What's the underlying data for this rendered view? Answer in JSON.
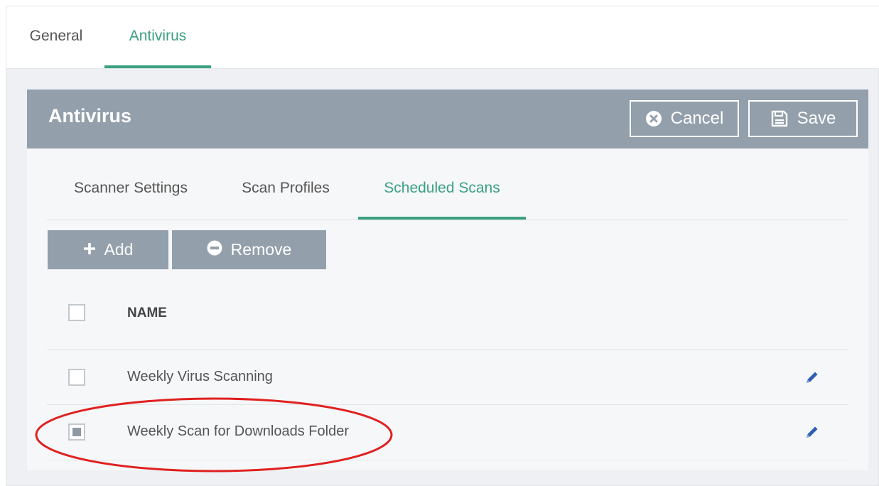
{
  "top_tabs": [
    {
      "label": "General",
      "active": false
    },
    {
      "label": "Antivirus",
      "active": true
    }
  ],
  "panel": {
    "title": "Antivirus",
    "cancel_label": "Cancel",
    "save_label": "Save"
  },
  "sub_tabs": [
    {
      "label": "Scanner Settings",
      "active": false
    },
    {
      "label": "Scan Profiles",
      "active": false
    },
    {
      "label": "Scheduled Scans",
      "active": true
    }
  ],
  "toolbar": {
    "add_label": "Add",
    "remove_label": "Remove"
  },
  "table": {
    "columns": [
      "NAME"
    ],
    "rows": [
      {
        "name": "Weekly Virus Scanning",
        "checked": false
      },
      {
        "name": "Weekly Scan for Downloads Folder",
        "checked": true
      }
    ]
  },
  "icons": {
    "cancel": "circle-x-icon",
    "save": "floppy-disk-icon",
    "add": "plus-icon",
    "remove": "circle-minus-icon",
    "edit": "pencil-icon"
  },
  "colors": {
    "accent": "#3aa17e",
    "header_bg": "#939fab",
    "annotation": "#e02020",
    "edit_icon": "#2f5fb3"
  }
}
